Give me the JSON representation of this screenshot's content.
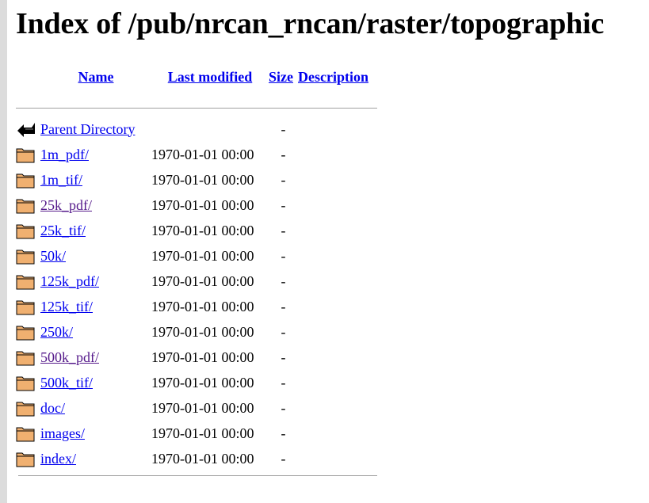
{
  "title": "Index of /pub/nrcan_rncan/raster/topographic",
  "header": {
    "name": "Name",
    "last_modified": "Last modified",
    "size": "Size",
    "description": "Description"
  },
  "parent": {
    "label": "Parent Directory",
    "size": "-"
  },
  "entries": [
    {
      "name": "1m_pdf/",
      "modified": "1970-01-01 00:00",
      "size": "-",
      "visited": false
    },
    {
      "name": "1m_tif/",
      "modified": "1970-01-01 00:00",
      "size": "-",
      "visited": false
    },
    {
      "name": "25k_pdf/",
      "modified": "1970-01-01 00:00",
      "size": "-",
      "visited": true
    },
    {
      "name": "25k_tif/",
      "modified": "1970-01-01 00:00",
      "size": "-",
      "visited": false
    },
    {
      "name": "50k/",
      "modified": "1970-01-01 00:00",
      "size": "-",
      "visited": false
    },
    {
      "name": "125k_pdf/",
      "modified": "1970-01-01 00:00",
      "size": "-",
      "visited": false
    },
    {
      "name": "125k_tif/",
      "modified": "1970-01-01 00:00",
      "size": "-",
      "visited": false
    },
    {
      "name": "250k/",
      "modified": "1970-01-01 00:00",
      "size": "-",
      "visited": false
    },
    {
      "name": "500k_pdf/",
      "modified": "1970-01-01 00:00",
      "size": "-",
      "visited": true
    },
    {
      "name": "500k_tif/",
      "modified": "1970-01-01 00:00",
      "size": "-",
      "visited": false
    },
    {
      "name": "doc/",
      "modified": "1970-01-01 00:00",
      "size": "-",
      "visited": false
    },
    {
      "name": "images/",
      "modified": "1970-01-01 00:00",
      "size": "-",
      "visited": false
    },
    {
      "name": "index/",
      "modified": "1970-01-01 00:00",
      "size": "-",
      "visited": false
    }
  ],
  "icons": {
    "folder": "folder-icon",
    "parent": "back-arrow-icon"
  },
  "colors": {
    "link": "#0000ee",
    "visited": "#551a8b",
    "folder": "#f0b070"
  }
}
